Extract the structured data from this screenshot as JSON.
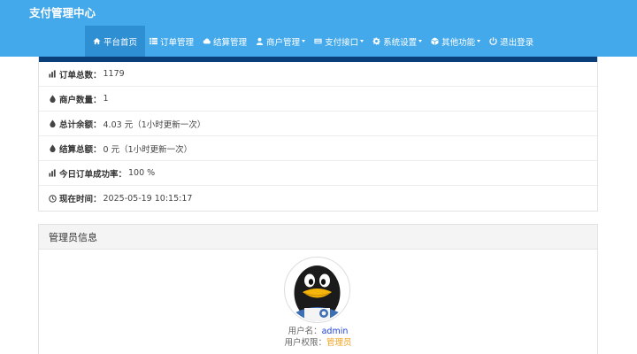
{
  "header": {
    "brand": "支付管理中心",
    "nav": [
      {
        "label": "平台首页",
        "icon": "home-icon",
        "active": true
      },
      {
        "label": "订单管理",
        "icon": "list-icon"
      },
      {
        "label": "结算管理",
        "icon": "cloud-icon"
      },
      {
        "label": "商户管理",
        "icon": "user-icon",
        "dropdown": true
      },
      {
        "label": "支付接口",
        "icon": "credit-card-icon",
        "dropdown": true
      },
      {
        "label": "系统设置",
        "icon": "gear-icon",
        "dropdown": true
      },
      {
        "label": "其他功能",
        "icon": "cube-icon",
        "dropdown": true
      },
      {
        "label": "退出登录",
        "icon": "power-icon"
      }
    ]
  },
  "stats": [
    {
      "label": "订单总数：",
      "value": "1179",
      "icon": "bar-chart-icon"
    },
    {
      "label": "商户数量：",
      "value": "1",
      "icon": "drop-icon"
    },
    {
      "label": "总计余额：",
      "value": "4.03 元（1小时更新一次）",
      "icon": "drop-icon"
    },
    {
      "label": "结算总额：",
      "value": "0 元（1小时更新一次）",
      "icon": "drop-icon"
    },
    {
      "label": "今日订单成功率：",
      "value": "100 %",
      "icon": "bar-chart-icon"
    },
    {
      "label": "现在时间：",
      "value": "2025-05-19 10:15:17",
      "icon": "clock-icon"
    }
  ],
  "admin": {
    "title": "管理员信息",
    "username_label": "用户名：",
    "username": "admin",
    "role_label": "用户权限：",
    "role": "管理员",
    "avatar_icon": "penguin-avatar-icon"
  },
  "colors": {
    "navbar": "#44a9ea",
    "nav_active": "#2e8fd3",
    "panel_accent": "#0a3f7a",
    "username": "#1f40e0",
    "role": "#f0a11e"
  }
}
